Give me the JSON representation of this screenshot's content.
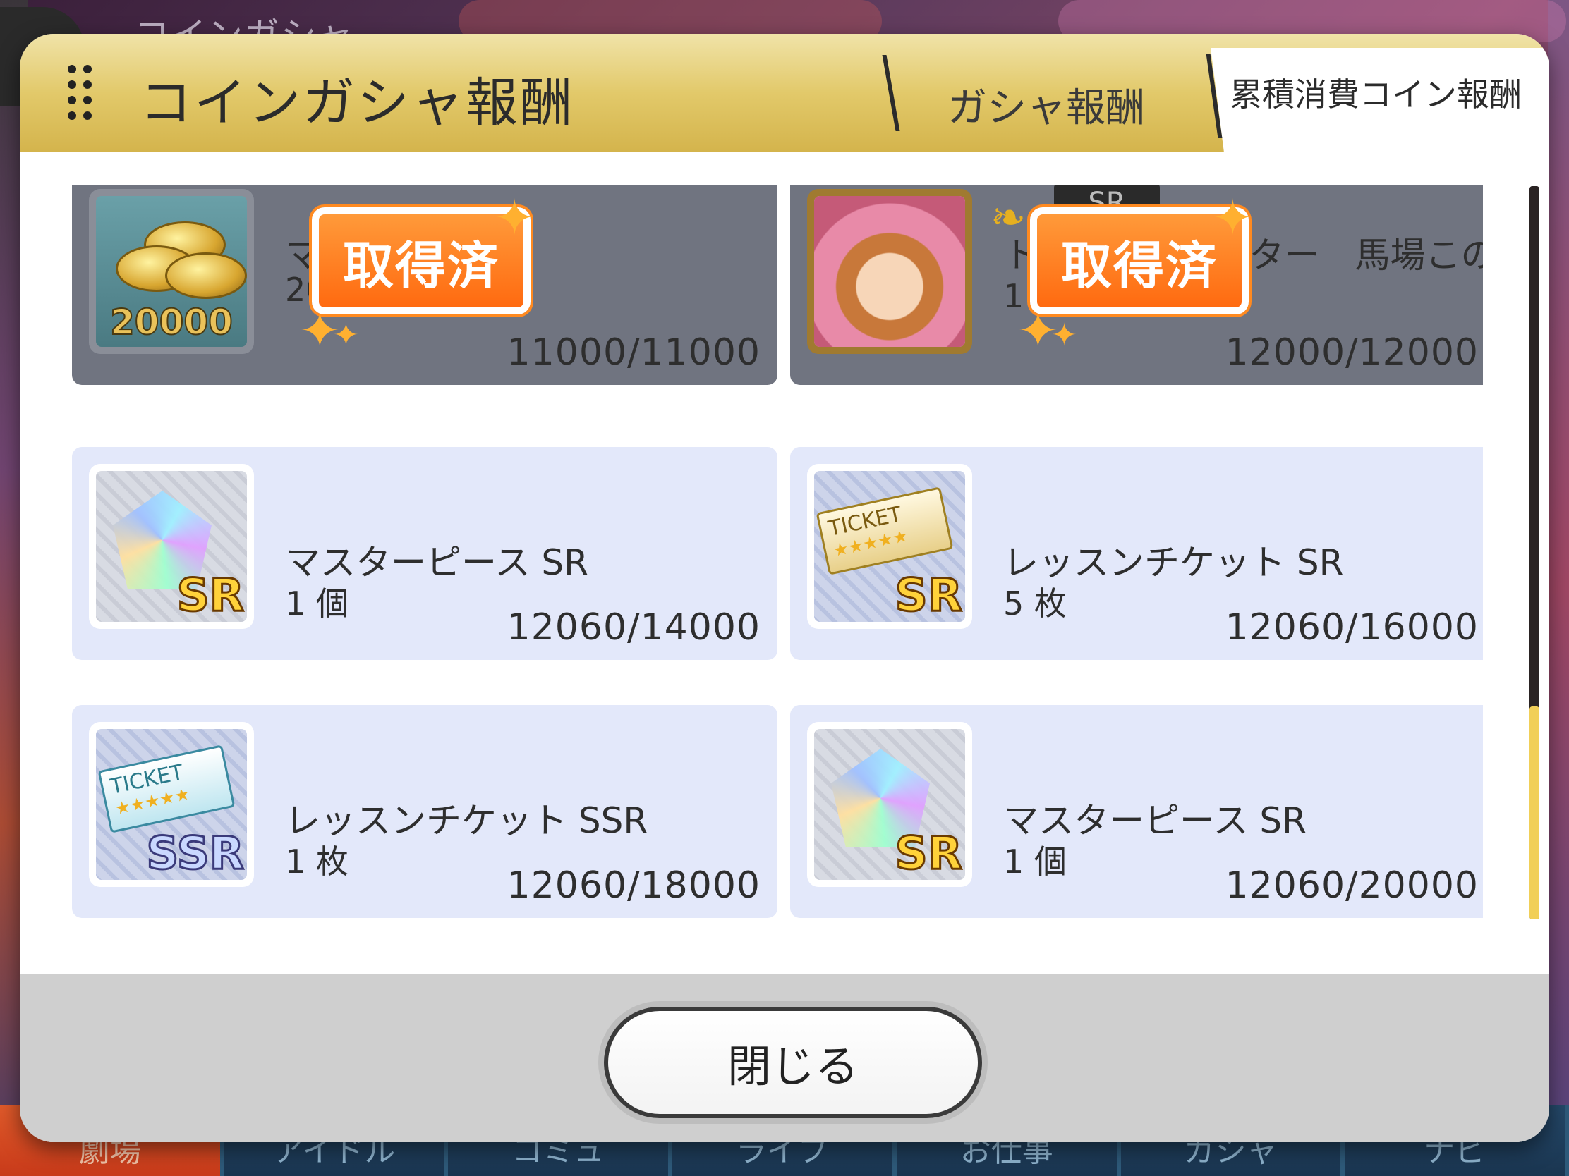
{
  "background": {
    "title": "コインガシャ"
  },
  "dialog": {
    "title": "コインガシャ報酬",
    "tabs": [
      {
        "label": "ガシャ報酬",
        "active": false
      },
      {
        "label": "累積消費コイン報酬",
        "active": true
      }
    ]
  },
  "rewards": [
    {
      "name": "マニー",
      "quantity": "20000",
      "progress": "11000/11000",
      "claimed": true,
      "badge": "取得済",
      "icon": "money-coins-icon",
      "icon_label": "20000"
    },
    {
      "name": "トゥインクルスター　馬場このみ",
      "quantity": "1 枚",
      "progress": "12000/12000",
      "claimed": true,
      "badge": "取得済",
      "icon": "idol-card-portrait-icon",
      "rarity": "SR"
    },
    {
      "name": "マスターピース SR",
      "quantity": "1 個",
      "progress": "12060/14000",
      "claimed": false,
      "icon": "masterpiece-gem-icon",
      "rarity": "SR"
    },
    {
      "name": "レッスンチケット SR",
      "quantity": "5 枚",
      "progress": "12060/16000",
      "claimed": false,
      "icon": "lesson-ticket-icon",
      "rarity": "SR",
      "ticket_text": "TICKET"
    },
    {
      "name": "レッスンチケット SSR",
      "quantity": "1 枚",
      "progress": "12060/18000",
      "claimed": false,
      "icon": "lesson-ticket-icon",
      "rarity": "SSR",
      "ticket_text": "TICKET"
    },
    {
      "name": "マスターピース SR",
      "quantity": "1 個",
      "progress": "12060/20000",
      "claimed": false,
      "icon": "masterpiece-gem-icon",
      "rarity": "SR"
    }
  ],
  "footer": {
    "close_label": "閉じる"
  },
  "bottom_nav": [
    "劇場",
    "アイドル",
    "コミュ",
    "ライブ",
    "お仕事",
    "ガシャ",
    "ナビ"
  ],
  "colors": {
    "accent_gold": "#e2c96a",
    "claimed_bg": "#707480",
    "card_bg": "#e3e8fa",
    "badge_orange": "#ff7a1a"
  }
}
